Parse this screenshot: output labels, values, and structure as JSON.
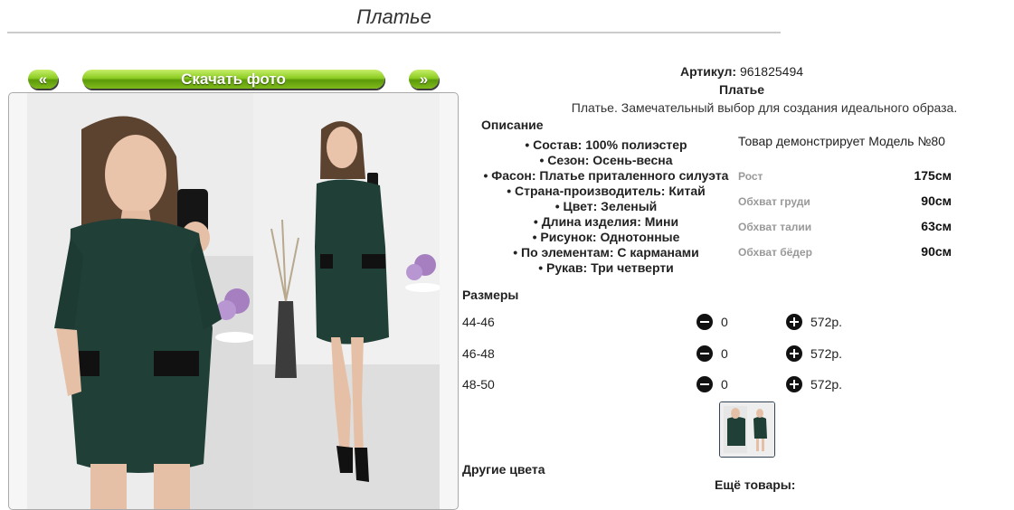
{
  "page": {
    "title": "Платье"
  },
  "gallery": {
    "prev_label": "«",
    "download_label": "Скачать фото",
    "next_label": "»"
  },
  "product": {
    "article_label": "Артикул:",
    "article_value": "961825494",
    "name": "Платье",
    "tagline": "Платье. Замечательный выбор для создания идеального образа.",
    "description_title": "Описание",
    "properties": [
      "• Состав: 100% полиэстер",
      "• Сезон: Осень-весна",
      "• Фасон: Платье приталенного силуэта",
      "• Страна-производитель: Китай",
      "• Цвет: Зеленый",
      "• Длина изделия: Мини",
      "• Рисунок: Однотонные",
      "• По элементам: С карманами",
      "• Рукав: Три четверти"
    ]
  },
  "model": {
    "title": "Товар демонстрирует Модель №80",
    "rows": [
      {
        "key": "Рост",
        "value": "175см"
      },
      {
        "key": "Обхват груди",
        "value": "90см"
      },
      {
        "key": "Обхват талии",
        "value": "63см"
      },
      {
        "key": "Обхват бёдер",
        "value": "90см"
      }
    ]
  },
  "sizes": {
    "title": "Размеры",
    "rows": [
      {
        "size": "44-46",
        "qty": "0",
        "price": "572р."
      },
      {
        "size": "46-48",
        "qty": "0",
        "price": "572р."
      },
      {
        "size": "48-50",
        "qty": "0",
        "price": "572р."
      }
    ]
  },
  "footer": {
    "other_colors": "Другие цвета",
    "more_goods": "Ещё товары:"
  },
  "colors": {
    "accent_green": "#7fba1a",
    "dress_green": "#1f3d35"
  }
}
